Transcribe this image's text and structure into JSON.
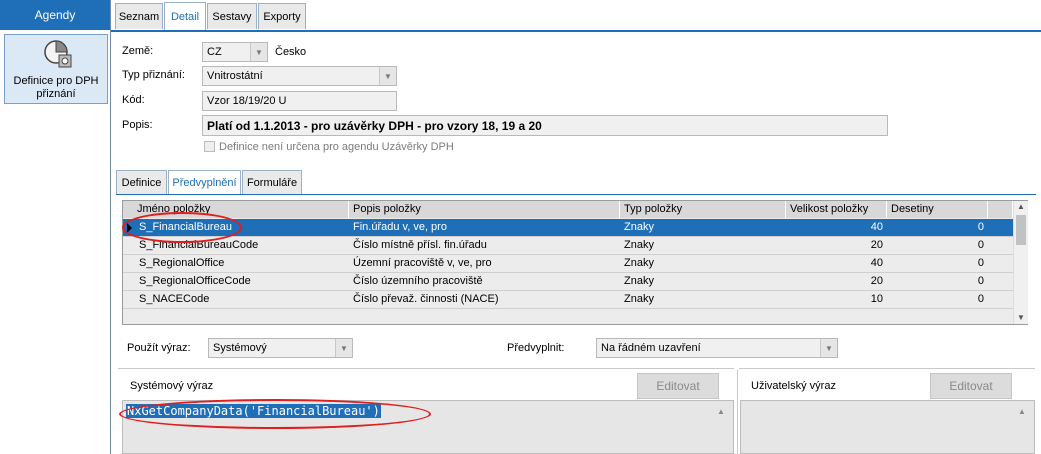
{
  "sidebar": {
    "header": "Agendy",
    "items": [
      {
        "label": "Definice pro DPH přiznání",
        "icon": "tax-definition-icon"
      }
    ]
  },
  "top_tabs": [
    "Seznam",
    "Detail",
    "Sestavy",
    "Exporty"
  ],
  "form": {
    "zeme_label": "Země:",
    "zeme_code": "CZ",
    "zeme_name": "Česko",
    "typ_label": "Typ přiznání:",
    "typ_value": "Vnitrostátní",
    "kod_label": "Kód:",
    "kod_value": "Vzor 18/19/20 U",
    "popis_label": "Popis:",
    "popis_value": "Platí od 1.1.2013 - pro uzávěrky DPH - pro vzory 18, 19 a 20",
    "checkbox_label": "Definice není určena pro agendu Uzávěrky DPH"
  },
  "inner_tabs": [
    "Definice",
    "Předvyplnění",
    "Formuláře"
  ],
  "grid": {
    "columns": [
      "Jméno položky",
      "Popis položky",
      "Typ položky",
      "Velikost položky",
      "Desetiny"
    ],
    "rows": [
      [
        "S_FinancialBureau",
        "Fin.úřadu v, ve, pro",
        "Znaky",
        "40",
        "0"
      ],
      [
        "S_FinancialBureauCode",
        "Číslo místně přísl. fin.úřadu",
        "Znaky",
        "20",
        "0"
      ],
      [
        "S_RegionalOffice",
        "Územní pracoviště v, ve, pro",
        "Znaky",
        "40",
        "0"
      ],
      [
        "S_RegionalOfficeCode",
        "Číslo územního pracoviště",
        "Znaky",
        "20",
        "0"
      ],
      [
        "S_NACECode",
        "Číslo převaž. činnosti (NACE)",
        "Znaky",
        "10",
        "0"
      ]
    ]
  },
  "bottom": {
    "pouzit_label": "Použít výraz:",
    "pouzit_value": "Systémový",
    "predvyplnit_label": "Předvyplnit:",
    "predvyplnit_value": "Na řádném uzavření",
    "system_label": "Systémový výraz",
    "edit_label": "Editovat",
    "user_label": "Uživatelský výraz",
    "expression": "NxGetCompanyData('FinancialBureau')"
  },
  "colors": {
    "accent": "#1e6fb8",
    "highlight": "#e11d1d"
  }
}
